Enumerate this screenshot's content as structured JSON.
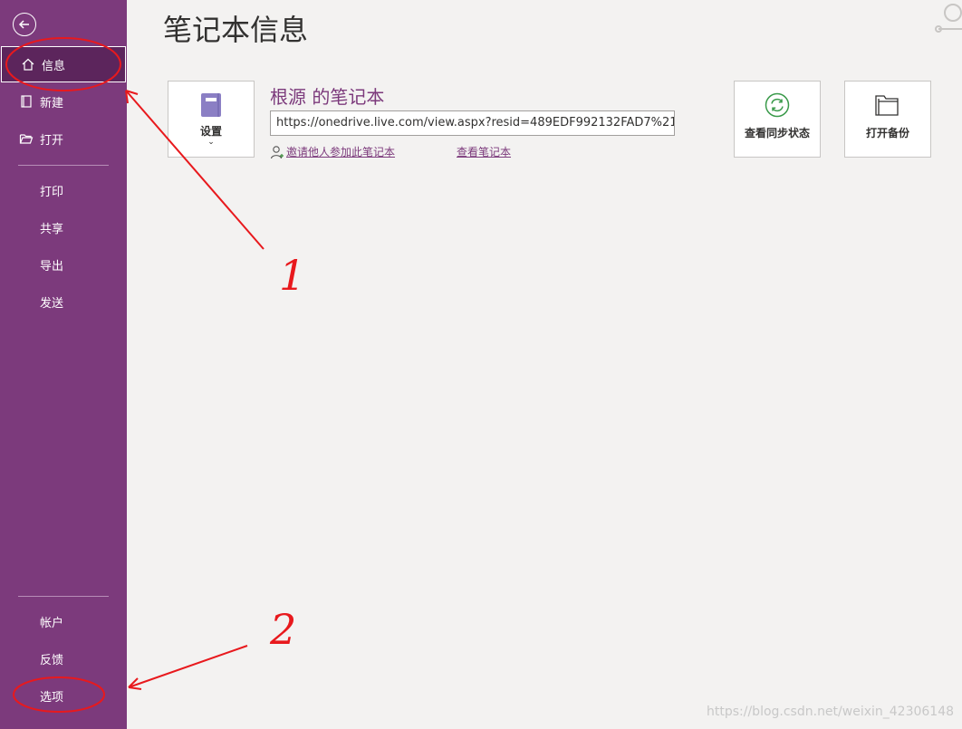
{
  "sidebar": {
    "back_icon": "back-arrow-icon",
    "items_top": [
      {
        "label": "信息",
        "icon": "home-icon"
      },
      {
        "label": "新建",
        "icon": "new-page-icon"
      },
      {
        "label": "打开",
        "icon": "folder-open-icon"
      }
    ],
    "items_mid": [
      "打印",
      "共享",
      "导出",
      "发送"
    ],
    "items_bottom": [
      "帐户",
      "反馈",
      "选项"
    ],
    "colors": {
      "background": "#7c3a7c",
      "active": "#5c255c"
    }
  },
  "main": {
    "title": "笔记本信息",
    "settings_label": "设置",
    "notebook_name": "根源 的笔记本",
    "url": "https://onedrive.live.com/view.aspx?resid=489EDF992132FAD7%21...",
    "invite_link": "邀请他人参加此笔记本",
    "view_link": "查看笔记本",
    "sync_label": "查看同步状态",
    "backup_label": "打开备份"
  },
  "annotations": {
    "label_1": "1",
    "label_2": "2",
    "color": "#e8191d"
  },
  "watermark": "https://blog.csdn.net/weixin_42306148"
}
